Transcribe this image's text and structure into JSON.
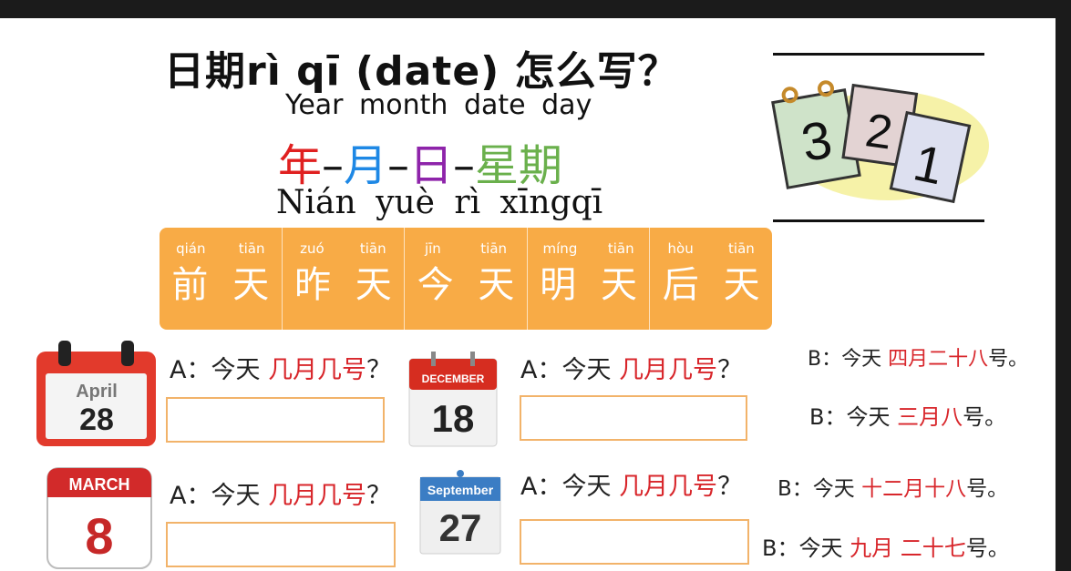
{
  "title": "日期rì qī (date) 怎么写？",
  "subtitle": "Year month date day",
  "order": [
    {
      "text": "年",
      "color": "#e02020"
    },
    {
      "text": "–",
      "color": "#111111"
    },
    {
      "text": "月",
      "color": "#1e88e5"
    },
    {
      "text": "–",
      "color": "#111111"
    },
    {
      "text": "日",
      "color": "#8e24aa"
    },
    {
      "text": "–",
      "color": "#111111"
    },
    {
      "text": "星期",
      "color": "#6ab04c"
    }
  ],
  "pinyin_line": "Nián yuè rì xīngqī",
  "days": [
    {
      "py1": "qián",
      "py2": "tiān",
      "hz1": "前",
      "hz2": "天"
    },
    {
      "py1": "zuó",
      "py2": "tiān",
      "hz1": "昨",
      "hz2": "天"
    },
    {
      "py1": "jīn",
      "py2": "tiān",
      "hz1": "今",
      "hz2": "天"
    },
    {
      "py1": "míng",
      "py2": "tiān",
      "hz1": "明",
      "hz2": "天"
    },
    {
      "py1": "hòu",
      "py2": "tiān",
      "hz1": "后",
      "hz2": "天"
    }
  ],
  "calendars": {
    "april": {
      "month": "April",
      "day": "28"
    },
    "december": {
      "month": "DECEMBER",
      "day": "18"
    },
    "march": {
      "month": "MARCH",
      "day": "8"
    },
    "september": {
      "month": "September",
      "day": "27"
    }
  },
  "clipart": {
    "n1": "3",
    "n2": "2",
    "n3": "1"
  },
  "question": {
    "prefix": "A：今天 ",
    "red": "几月几号",
    "suffix": "？"
  },
  "answers": [
    {
      "prefix": "B：今天 ",
      "red": "四月二十八",
      "suffix": "号。"
    },
    {
      "prefix": "B：今天 ",
      "red": "三月八",
      "suffix": "号。"
    },
    {
      "prefix": "B：今天 ",
      "red": "十二月十八",
      "suffix": "号。"
    },
    {
      "prefix": "B：今天 ",
      "red": "九月 二十七",
      "suffix": "号。"
    }
  ]
}
